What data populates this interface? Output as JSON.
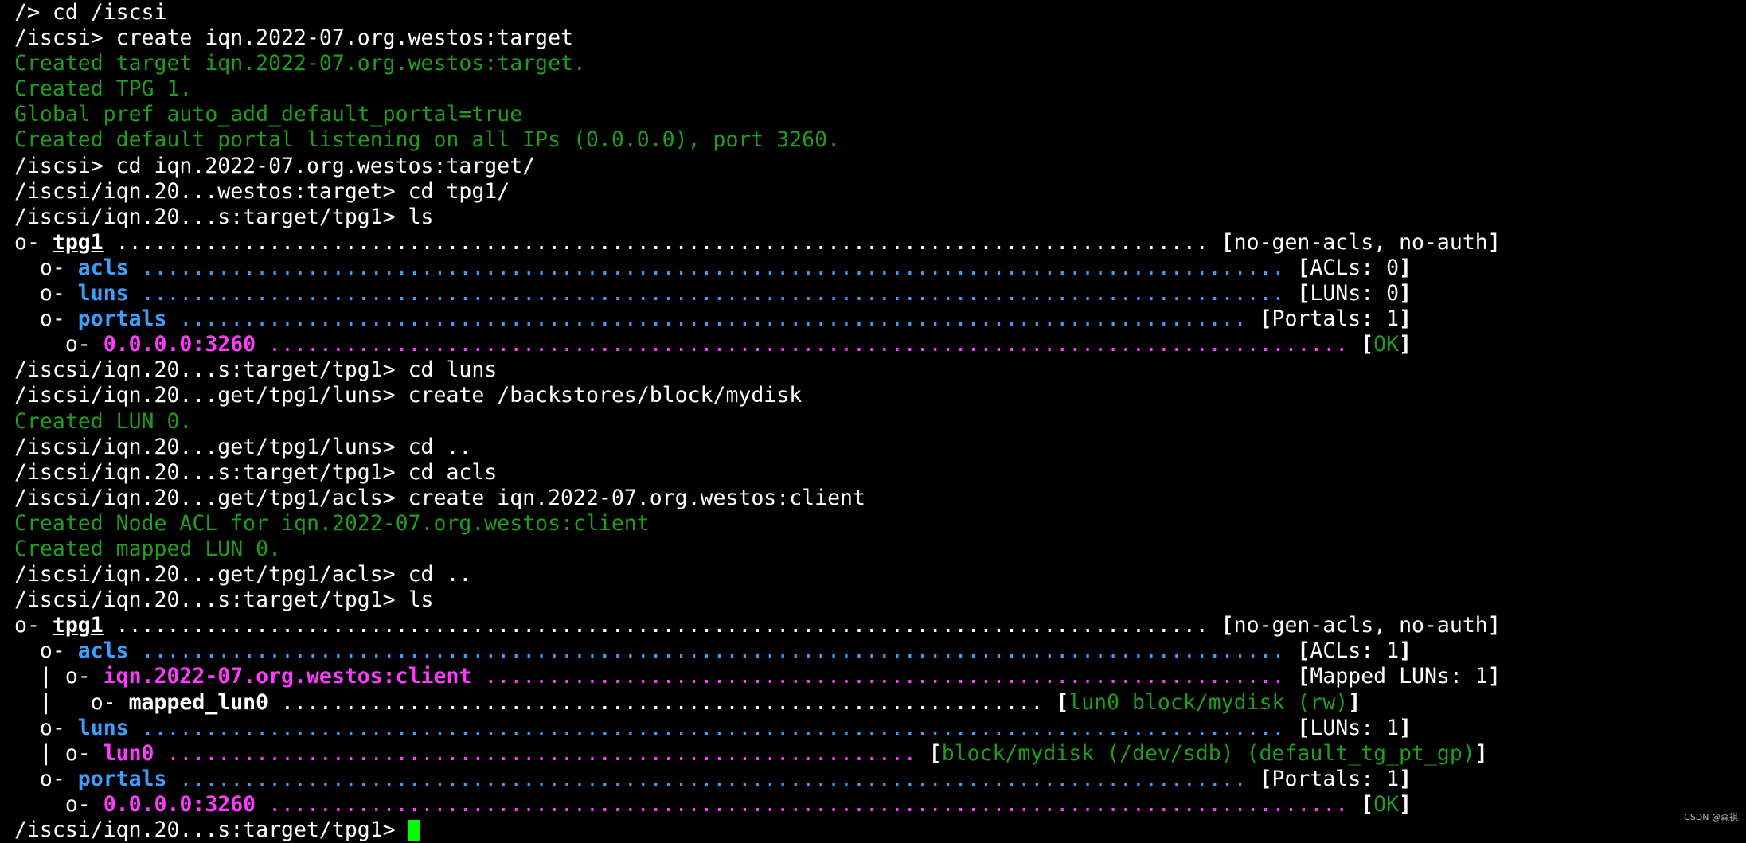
{
  "colors": {
    "background": "#000000",
    "default": "#ffffff",
    "green": "#1f9d1f",
    "blue": "#3a9fff",
    "magenta": "#ff3bff",
    "gray": "#cfcfcf",
    "cursor": "#00ff00"
  },
  "watermark": "CSDN @森祺",
  "lines": [
    [
      {
        "t": "/> cd /iscsi",
        "c": "default"
      }
    ],
    [
      {
        "t": "/iscsi> create iqn.2022-07.org.westos:target",
        "c": "default"
      }
    ],
    [
      {
        "t": "Created target iqn.2022-07.org.westos:target.",
        "c": "green"
      }
    ],
    [
      {
        "t": "Created TPG 1.",
        "c": "green"
      }
    ],
    [
      {
        "t": "Global pref auto_add_default_portal=true",
        "c": "green"
      }
    ],
    [
      {
        "t": "Created default portal listening on all IPs (0.0.0.0), port 3260.",
        "c": "green"
      }
    ],
    [
      {
        "t": "/iscsi> cd iqn.2022-07.org.westos:target/",
        "c": "default"
      }
    ],
    [
      {
        "t": "/iscsi/iqn.20...westos:target> cd tpg1/",
        "c": "default"
      }
    ],
    [
      {
        "t": "/iscsi/iqn.20...s:target/tpg1> ls",
        "c": "default"
      }
    ],
    [
      {
        "t": "o- ",
        "c": "default"
      },
      {
        "t": "tpg1",
        "c": "default",
        "b": 1,
        "u": 1
      },
      {
        "t": " ...................................................................................... ",
        "c": "default"
      },
      {
        "t": "[",
        "c": "default",
        "b": 1
      },
      {
        "t": "no-gen-acls, no-auth",
        "c": "default"
      },
      {
        "t": "]",
        "c": "default",
        "b": 1
      }
    ],
    [
      {
        "t": "  o- ",
        "c": "default"
      },
      {
        "t": "acls",
        "c": "blue",
        "b": 1
      },
      {
        "t": " .......................................................................................... ",
        "c": "blue"
      },
      {
        "t": "[",
        "c": "default",
        "b": 1
      },
      {
        "t": "ACLs: 0",
        "c": "default"
      },
      {
        "t": "]",
        "c": "default",
        "b": 1
      }
    ],
    [
      {
        "t": "  o- ",
        "c": "default"
      },
      {
        "t": "luns",
        "c": "blue",
        "b": 1
      },
      {
        "t": " .......................................................................................... ",
        "c": "blue"
      },
      {
        "t": "[",
        "c": "default",
        "b": 1
      },
      {
        "t": "LUNs: 0",
        "c": "default"
      },
      {
        "t": "]",
        "c": "default",
        "b": 1
      }
    ],
    [
      {
        "t": "  o- ",
        "c": "default"
      },
      {
        "t": "portals",
        "c": "blue",
        "b": 1
      },
      {
        "t": " .................................................................................... ",
        "c": "blue"
      },
      {
        "t": "[",
        "c": "default",
        "b": 1
      },
      {
        "t": "Portals: 1",
        "c": "default"
      },
      {
        "t": "]",
        "c": "default",
        "b": 1
      }
    ],
    [
      {
        "t": "    o- ",
        "c": "default"
      },
      {
        "t": "0.0.0.0:3260",
        "c": "magenta",
        "b": 1
      },
      {
        "t": " ..................................................................................... ",
        "c": "magenta"
      },
      {
        "t": "[",
        "c": "default",
        "b": 1
      },
      {
        "t": "OK",
        "c": "green"
      },
      {
        "t": "]",
        "c": "default",
        "b": 1
      }
    ],
    [
      {
        "t": "/iscsi/iqn.20...s:target/tpg1> cd luns",
        "c": "default"
      }
    ],
    [
      {
        "t": "/iscsi/iqn.20...get/tpg1/luns> create /backstores/block/mydisk",
        "c": "default"
      }
    ],
    [
      {
        "t": "Created LUN 0.",
        "c": "green"
      }
    ],
    [
      {
        "t": "/iscsi/iqn.20...get/tpg1/luns> cd ..",
        "c": "default"
      }
    ],
    [
      {
        "t": "/iscsi/iqn.20...s:target/tpg1> cd acls",
        "c": "default"
      }
    ],
    [
      {
        "t": "/iscsi/iqn.20...get/tpg1/acls> create iqn.2022-07.org.westos:client",
        "c": "default"
      }
    ],
    [
      {
        "t": "Created Node ACL for iqn.2022-07.org.westos:client",
        "c": "green"
      }
    ],
    [
      {
        "t": "Created mapped LUN 0.",
        "c": "green"
      }
    ],
    [
      {
        "t": "/iscsi/iqn.20...get/tpg1/acls> cd ..",
        "c": "default"
      }
    ],
    [
      {
        "t": "/iscsi/iqn.20...s:target/tpg1> ls",
        "c": "default"
      }
    ],
    [
      {
        "t": "o- ",
        "c": "default"
      },
      {
        "t": "tpg1",
        "c": "default",
        "b": 1,
        "u": 1
      },
      {
        "t": " ...................................................................................... ",
        "c": "default"
      },
      {
        "t": "[",
        "c": "default",
        "b": 1
      },
      {
        "t": "no-gen-acls, no-auth",
        "c": "default"
      },
      {
        "t": "]",
        "c": "default",
        "b": 1
      }
    ],
    [
      {
        "t": "  o- ",
        "c": "default"
      },
      {
        "t": "acls",
        "c": "blue",
        "b": 1
      },
      {
        "t": " .......................................................................................... ",
        "c": "blue"
      },
      {
        "t": "[",
        "c": "default",
        "b": 1
      },
      {
        "t": "ACLs: 1",
        "c": "default"
      },
      {
        "t": "]",
        "c": "default",
        "b": 1
      }
    ],
    [
      {
        "t": "  | o- ",
        "c": "default"
      },
      {
        "t": "iqn.2022-07.org.westos:client",
        "c": "magenta",
        "b": 1
      },
      {
        "t": " ............................................................... ",
        "c": "magenta"
      },
      {
        "t": "[",
        "c": "default",
        "b": 1
      },
      {
        "t": "Mapped LUNs: 1",
        "c": "default"
      },
      {
        "t": "]",
        "c": "default",
        "b": 1
      }
    ],
    [
      {
        "t": "  |   o- ",
        "c": "default"
      },
      {
        "t": "mapped_lun0",
        "c": "default",
        "b": 1
      },
      {
        "t": " ............................................................ ",
        "c": "default"
      },
      {
        "t": "[",
        "c": "default",
        "b": 1
      },
      {
        "t": "lun0 block/mydisk (rw)",
        "c": "green"
      },
      {
        "t": "]",
        "c": "default",
        "b": 1
      }
    ],
    [
      {
        "t": "  o- ",
        "c": "default"
      },
      {
        "t": "luns",
        "c": "blue",
        "b": 1
      },
      {
        "t": " .......................................................................................... ",
        "c": "blue"
      },
      {
        "t": "[",
        "c": "default",
        "b": 1
      },
      {
        "t": "LUNs: 1",
        "c": "default"
      },
      {
        "t": "]",
        "c": "default",
        "b": 1
      }
    ],
    [
      {
        "t": "  | o- ",
        "c": "default"
      },
      {
        "t": "lun0",
        "c": "magenta",
        "b": 1
      },
      {
        "t": " ........................................................... ",
        "c": "magenta"
      },
      {
        "t": "[",
        "c": "default",
        "b": 1
      },
      {
        "t": "block/mydisk (/dev/sdb) (default_tg_pt_gp)",
        "c": "green"
      },
      {
        "t": "]",
        "c": "default",
        "b": 1
      }
    ],
    [
      {
        "t": "  o- ",
        "c": "default"
      },
      {
        "t": "portals",
        "c": "blue",
        "b": 1
      },
      {
        "t": " .................................................................................... ",
        "c": "blue"
      },
      {
        "t": "[",
        "c": "default",
        "b": 1
      },
      {
        "t": "Portals: 1",
        "c": "default"
      },
      {
        "t": "]",
        "c": "default",
        "b": 1
      }
    ],
    [
      {
        "t": "    o- ",
        "c": "default"
      },
      {
        "t": "0.0.0.0:3260",
        "c": "magenta",
        "b": 1
      },
      {
        "t": " ..................................................................................... ",
        "c": "magenta"
      },
      {
        "t": "[",
        "c": "default",
        "b": 1
      },
      {
        "t": "OK",
        "c": "green"
      },
      {
        "t": "]",
        "c": "default",
        "b": 1
      }
    ],
    [
      {
        "t": "/iscsi/iqn.20...s:target/tpg1> ",
        "c": "default"
      }
    ]
  ]
}
